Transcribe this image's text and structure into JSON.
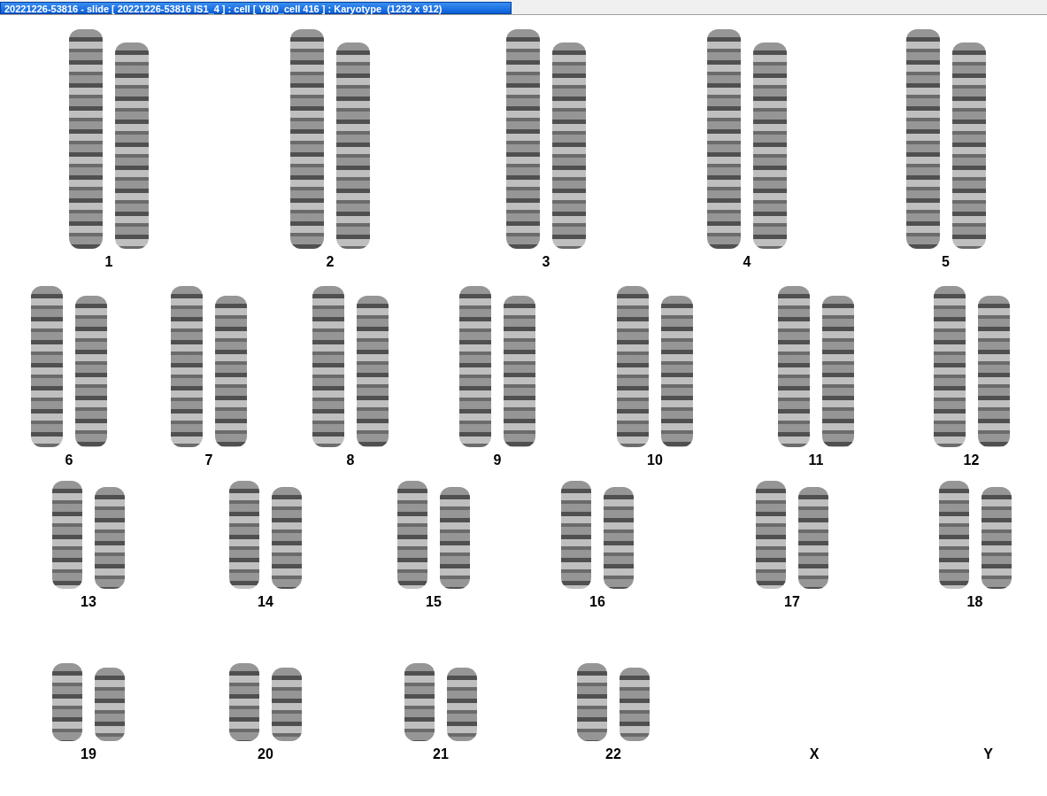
{
  "window": {
    "title": "20221226-53816 - slide [ 20221226-53816 IS1_4 ] : cell [ Y8/0_cell 416 ] : Karyotype  (1232 x 912)"
  },
  "chromosomes": [
    {
      "label": "1",
      "kind": "pair"
    },
    {
      "label": "2",
      "kind": "pair"
    },
    {
      "label": "3",
      "kind": "pair"
    },
    {
      "label": "4",
      "kind": "pair"
    },
    {
      "label": "5",
      "kind": "pair"
    },
    {
      "label": "6",
      "kind": "pair"
    },
    {
      "label": "7",
      "kind": "pair"
    },
    {
      "label": "8",
      "kind": "pair"
    },
    {
      "label": "9",
      "kind": "pair"
    },
    {
      "label": "10",
      "kind": "pair"
    },
    {
      "label": "11",
      "kind": "pair"
    },
    {
      "label": "12",
      "kind": "pair"
    },
    {
      "label": "13",
      "kind": "pair"
    },
    {
      "label": "14",
      "kind": "pair"
    },
    {
      "label": "15",
      "kind": "pair"
    },
    {
      "label": "16",
      "kind": "pair"
    },
    {
      "label": "17",
      "kind": "pair"
    },
    {
      "label": "18",
      "kind": "pair"
    },
    {
      "label": "19",
      "kind": "pair"
    },
    {
      "label": "20",
      "kind": "pair"
    },
    {
      "label": "21",
      "kind": "pair"
    },
    {
      "label": "22",
      "kind": "pair"
    },
    {
      "label": "X",
      "kind": "empty"
    },
    {
      "label": "Y",
      "kind": "empty"
    }
  ]
}
